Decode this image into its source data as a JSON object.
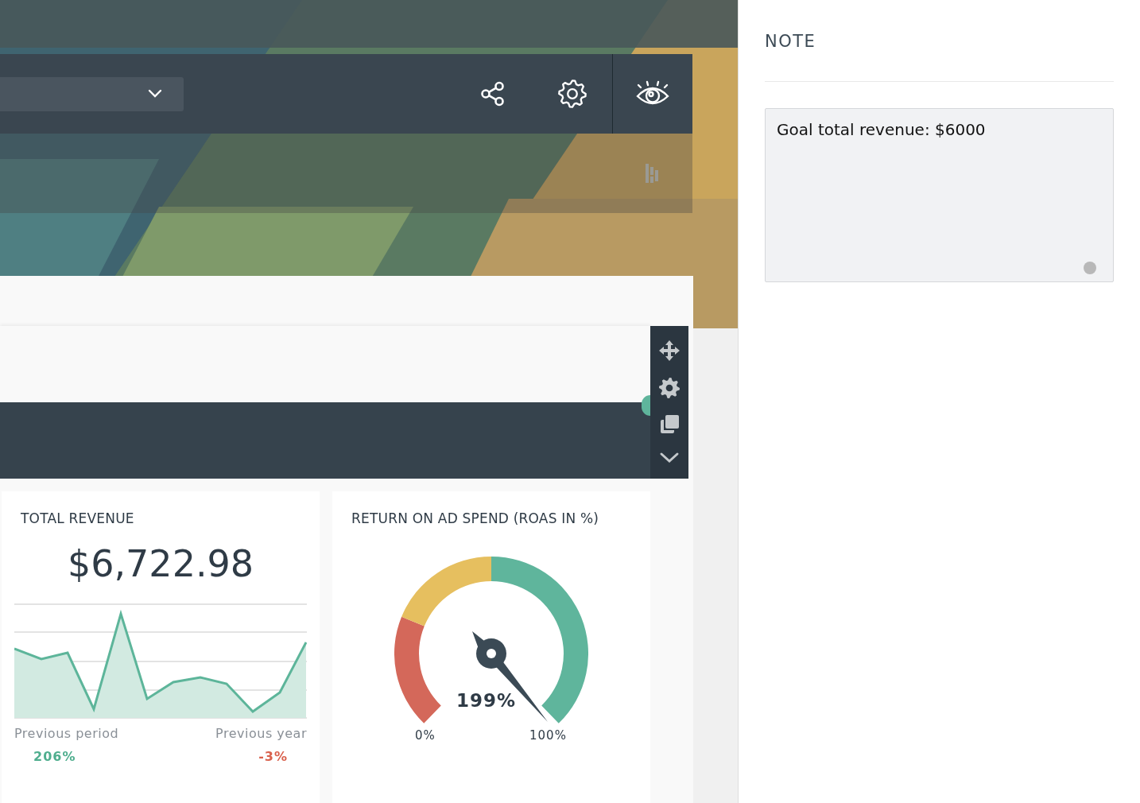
{
  "revenue_card": {
    "title": "TOTAL REVENUE",
    "value": "$6,722.98",
    "comparisons": [
      {
        "label": "Previous period",
        "change": "206%",
        "color": "#4fae8e"
      },
      {
        "label": "Previous year",
        "change": "-3%",
        "color": "#d9604c"
      }
    ]
  },
  "roas_card": {
    "title": "RETURN ON AD SPEND (ROAS IN %)",
    "reading": "199%",
    "min_label": "0%",
    "max_label": "100%"
  },
  "note_panel": {
    "title": "NOTE",
    "value": "Goal total revenue: $6000"
  }
}
